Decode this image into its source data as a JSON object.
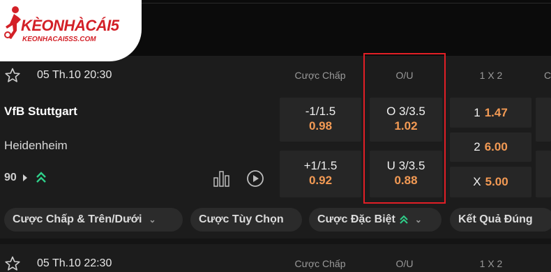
{
  "logo": {
    "name": "KÈONHÀCÁI5",
    "url": "KEONHACAI5SS.COM"
  },
  "columns": {
    "handicap": "Cược Chấp",
    "ou": "O/U",
    "onextwo": "1 X 2"
  },
  "match1": {
    "time": "05 Th.10 20:30",
    "home": "VfB Stuttgart",
    "away": "Heidenheim",
    "minute": "90",
    "handicap": [
      {
        "line": "-1/1.5",
        "price": "0.98"
      },
      {
        "line": "+1/1.5",
        "price": "0.92"
      }
    ],
    "ou": [
      {
        "line": "O 3/3.5",
        "price": "1.02"
      },
      {
        "line": "U 3/3.5",
        "price": "0.88"
      }
    ],
    "onextwo": [
      {
        "sel": "1",
        "price": "1.47"
      },
      {
        "sel": "2",
        "price": "6.00"
      },
      {
        "sel": "X",
        "price": "5.00"
      }
    ]
  },
  "tabs": [
    {
      "label": "Cược Chấp & Trên/Dưới"
    },
    {
      "label": "Cược Tùy Chọn"
    },
    {
      "label": "Cược Đặc Biệt"
    },
    {
      "label": "Kết Quả Đúng"
    }
  ],
  "match2": {
    "time": "05 Th.10 22:30"
  },
  "colors": {
    "accent_price": "#f39a54",
    "highlight": "#e21f26",
    "green": "#2fd08a"
  }
}
